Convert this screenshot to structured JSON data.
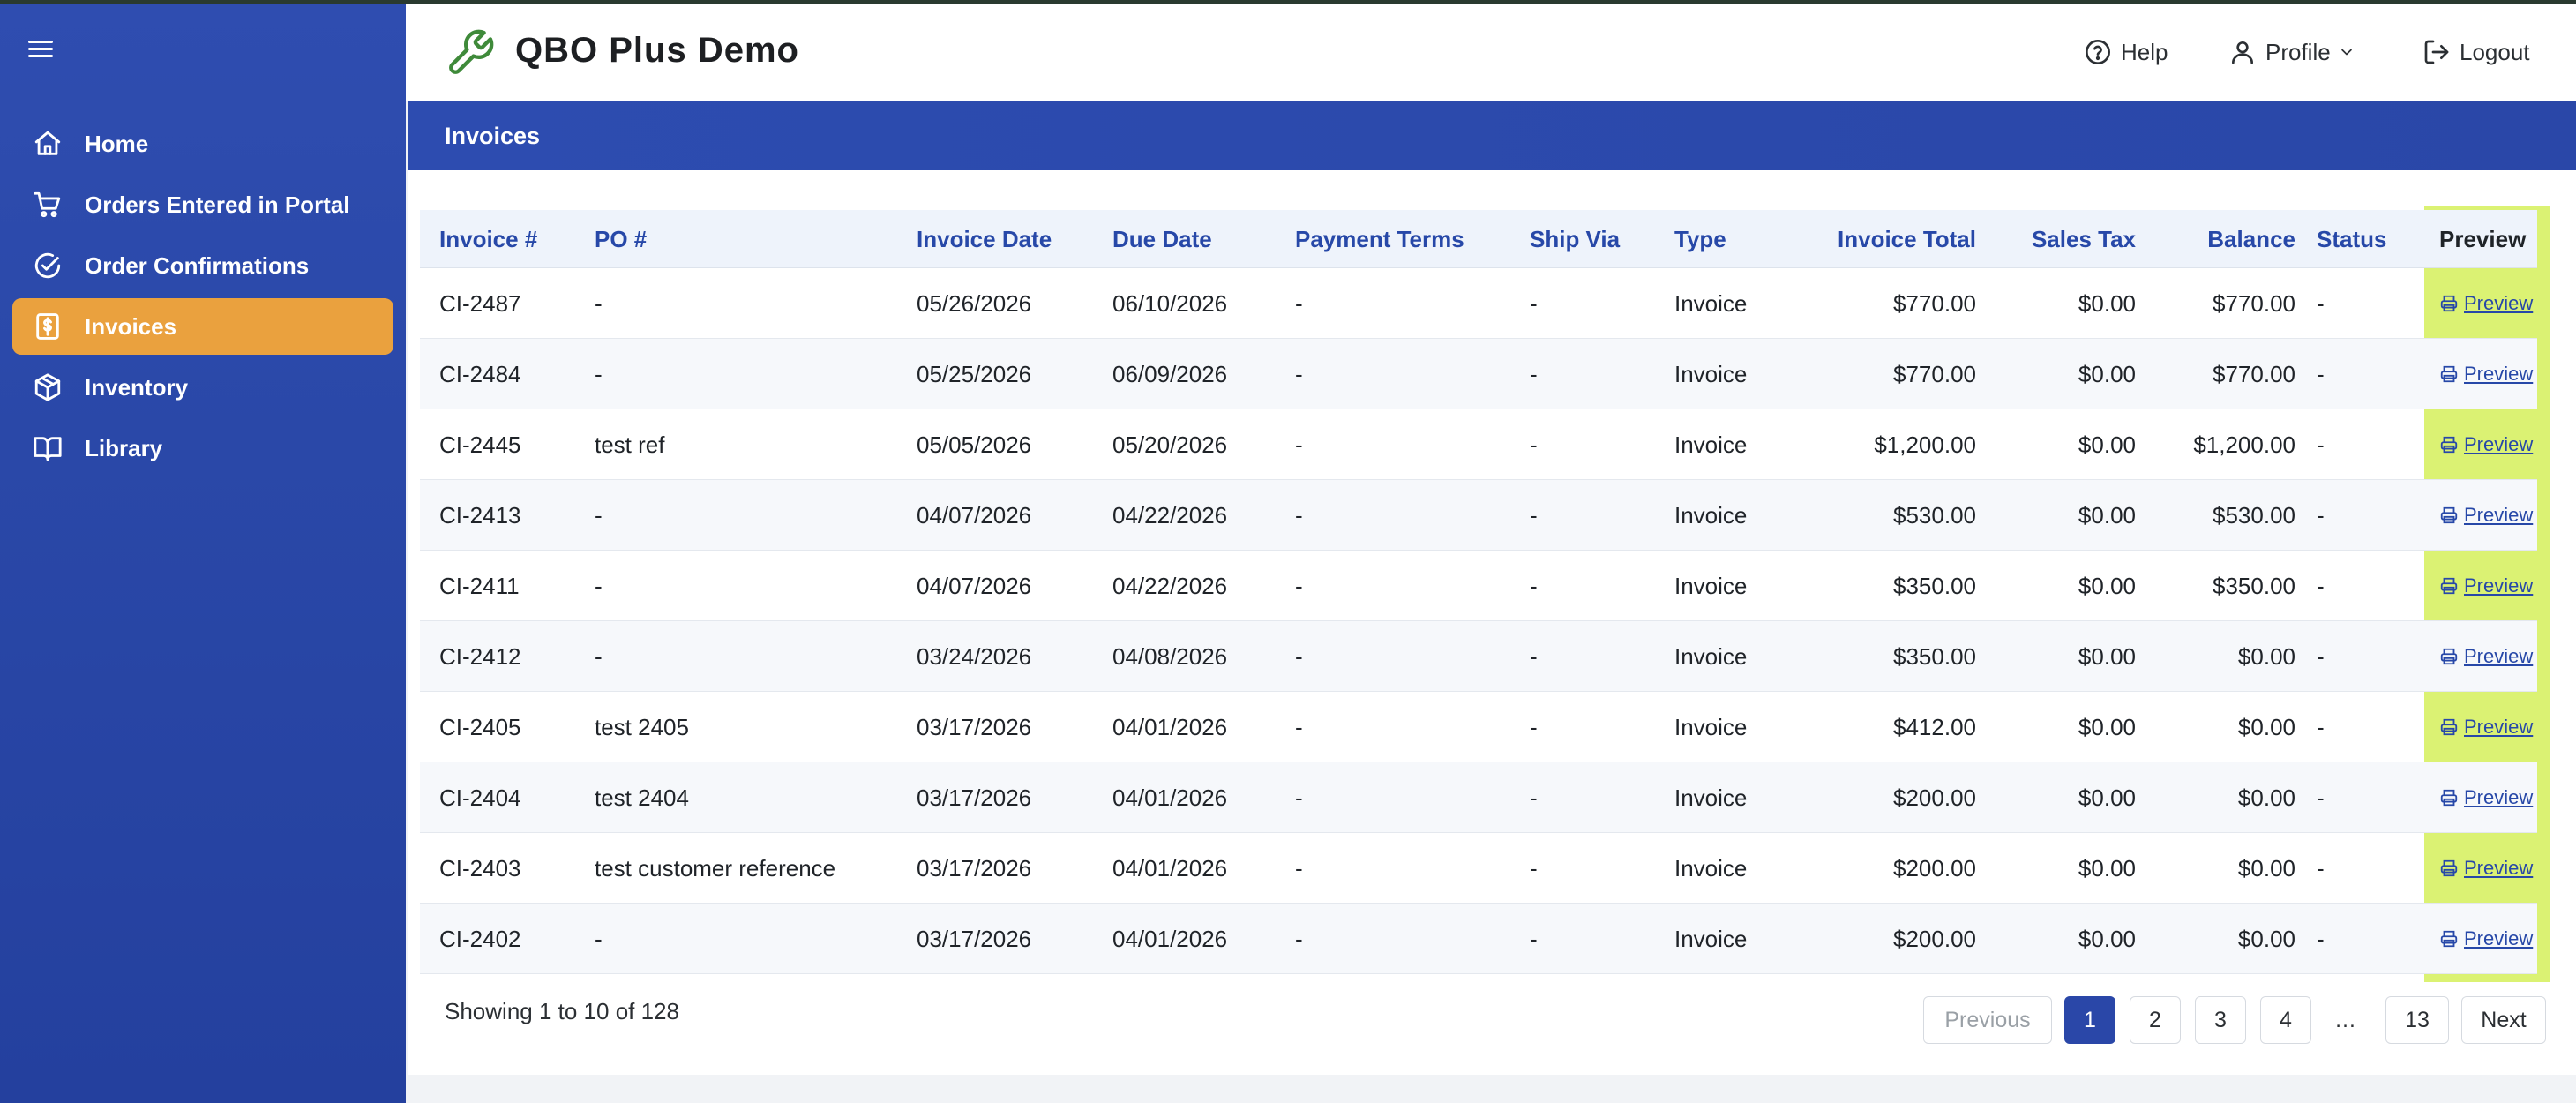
{
  "app": {
    "title": "QBO Plus Demo"
  },
  "sidebar": {
    "items": [
      {
        "label": "Home",
        "icon": "home-icon",
        "active": false
      },
      {
        "label": "Orders Entered in Portal",
        "icon": "cart-icon",
        "active": false
      },
      {
        "label": "Order Confirmations",
        "icon": "check-circle-icon",
        "active": false
      },
      {
        "label": "Invoices",
        "icon": "invoice-dollar-icon",
        "active": true
      },
      {
        "label": "Inventory",
        "icon": "box-icon",
        "active": false
      },
      {
        "label": "Library",
        "icon": "book-icon",
        "active": false
      }
    ]
  },
  "header": {
    "help": "Help",
    "profile": "Profile",
    "logout": "Logout"
  },
  "banner": {
    "title": "Invoices"
  },
  "table": {
    "columns": [
      "Invoice #",
      "PO #",
      "Invoice Date",
      "Due Date",
      "Payment Terms",
      "Ship Via",
      "Type",
      "Invoice Total",
      "Sales Tax",
      "Balance",
      "Status",
      "Preview"
    ],
    "rows": [
      [
        "CI-2487",
        "-",
        "05/26/2026",
        "06/10/2026",
        "-",
        "-",
        "Invoice",
        "$770.00",
        "$0.00",
        "$770.00",
        "-",
        "Preview"
      ],
      [
        "CI-2484",
        "-",
        "05/25/2026",
        "06/09/2026",
        "-",
        "-",
        "Invoice",
        "$770.00",
        "$0.00",
        "$770.00",
        "-",
        "Preview"
      ],
      [
        "CI-2445",
        "test ref",
        "05/05/2026",
        "05/20/2026",
        "-",
        "-",
        "Invoice",
        "$1,200.00",
        "$0.00",
        "$1,200.00",
        "-",
        "Preview"
      ],
      [
        "CI-2413",
        "-",
        "04/07/2026",
        "04/22/2026",
        "-",
        "-",
        "Invoice",
        "$530.00",
        "$0.00",
        "$530.00",
        "-",
        "Preview"
      ],
      [
        "CI-2411",
        "-",
        "04/07/2026",
        "04/22/2026",
        "-",
        "-",
        "Invoice",
        "$350.00",
        "$0.00",
        "$350.00",
        "-",
        "Preview"
      ],
      [
        "CI-2412",
        "-",
        "03/24/2026",
        "04/08/2026",
        "-",
        "-",
        "Invoice",
        "$350.00",
        "$0.00",
        "$0.00",
        "-",
        "Preview"
      ],
      [
        "CI-2405",
        "test 2405",
        "03/17/2026",
        "04/01/2026",
        "-",
        "-",
        "Invoice",
        "$412.00",
        "$0.00",
        "$0.00",
        "-",
        "Preview"
      ],
      [
        "CI-2404",
        "test 2404",
        "03/17/2026",
        "04/01/2026",
        "-",
        "-",
        "Invoice",
        "$200.00",
        "$0.00",
        "$0.00",
        "-",
        "Preview"
      ],
      [
        "CI-2403",
        "test customer reference",
        "03/17/2026",
        "04/01/2026",
        "-",
        "-",
        "Invoice",
        "$200.00",
        "$0.00",
        "$0.00",
        "-",
        "Preview"
      ],
      [
        "CI-2402",
        "-",
        "03/17/2026",
        "04/01/2026",
        "-",
        "-",
        "Invoice",
        "$200.00",
        "$0.00",
        "$0.00",
        "-",
        "Preview"
      ]
    ]
  },
  "pagination": {
    "summary": "Showing 1 to 10 of 128",
    "previous": "Previous",
    "pages": [
      "1",
      "2",
      "3",
      "4"
    ],
    "ellipsis": "…",
    "last": "13",
    "next": "Next",
    "current": "1"
  },
  "colors": {
    "sidebar": "#2a48a8",
    "active_nav": "#eaa13e",
    "header_text": "#2748a8",
    "preview_highlight": "#d5f05a"
  }
}
